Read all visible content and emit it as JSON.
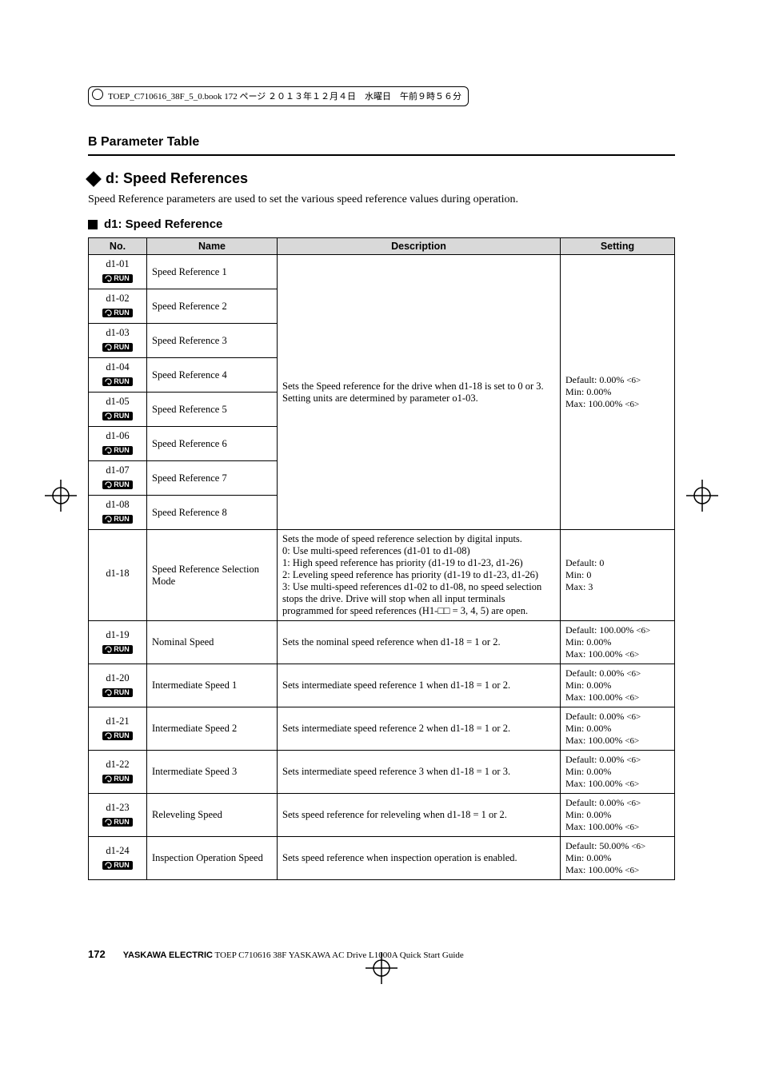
{
  "file_header": "TOEP_C710616_38F_5_0.book  172 ページ  ２０１３年１２月４日　水曜日　午前９時５６分",
  "section_header": "B  Parameter Table",
  "main_heading": "d: Speed References",
  "intro_text": "Speed Reference parameters are used to set the various speed reference values during operation.",
  "sub_heading": "d1: Speed Reference",
  "run_label": "RUN",
  "infinity_glyph": "<6>",
  "table": {
    "headers": {
      "no": "No.",
      "name": "Name",
      "description": "Description",
      "setting": "Setting"
    },
    "group_desc": "Sets the Speed reference for the drive when d1-18 is set to 0 or 3. Setting units are determined by parameter o1-03.",
    "group_setting": "Default: 0.00% <6>\nMin: 0.00%\nMax: 100.00% <6>",
    "group_rows": [
      {
        "no": "d1-01",
        "name": "Speed Reference 1",
        "run": true
      },
      {
        "no": "d1-02",
        "name": "Speed Reference 2",
        "run": true
      },
      {
        "no": "d1-03",
        "name": "Speed Reference 3",
        "run": true
      },
      {
        "no": "d1-04",
        "name": "Speed Reference 4",
        "run": true
      },
      {
        "no": "d1-05",
        "name": "Speed Reference 5",
        "run": true
      },
      {
        "no": "d1-06",
        "name": "Speed Reference 6",
        "run": true
      },
      {
        "no": "d1-07",
        "name": "Speed Reference 7",
        "run": true
      },
      {
        "no": "d1-08",
        "name": "Speed Reference 8",
        "run": true
      }
    ],
    "rows": [
      {
        "no": "d1-18",
        "run": false,
        "name": "Speed Reference Selection Mode",
        "description": "Sets the mode of speed reference selection by digital inputs.\n0: Use multi-speed references (d1-01 to d1-08)\n1: High speed reference has priority (d1-19 to d1-23, d1-26)\n2: Leveling speed reference has priority (d1-19 to d1-23, d1-26)\n3: Use multi-speed references d1-02 to d1-08, no speed selection stops the drive. Drive will stop when all input terminals programmed for speed references (H1-□□ = 3, 4, 5) are open.",
        "setting": "Default: 0\nMin: 0\nMax: 3"
      },
      {
        "no": "d1-19",
        "run": true,
        "name": "Nominal Speed",
        "description": "Sets the nominal speed reference when d1-18 = 1 or 2.",
        "setting": "Default: 100.00% <6>\nMin: 0.00%\nMax: 100.00% <6>"
      },
      {
        "no": "d1-20",
        "run": true,
        "name": "Intermediate Speed 1",
        "description": "Sets intermediate speed reference 1 when d1-18 = 1 or 2.",
        "setting": "Default: 0.00% <6>\nMin: 0.00%\nMax: 100.00% <6>"
      },
      {
        "no": "d1-21",
        "run": true,
        "name": "Intermediate Speed 2",
        "description": "Sets intermediate speed reference 2 when d1-18 = 1 or 2.",
        "setting": "Default: 0.00% <6>\nMin: 0.00%\nMax: 100.00% <6>"
      },
      {
        "no": "d1-22",
        "run": true,
        "name": "Intermediate Speed 3",
        "description": "Sets intermediate speed reference 3 when d1-18 = 1 or 3.",
        "setting": "Default: 0.00% <6>\nMin: 0.00%\nMax: 100.00% <6>"
      },
      {
        "no": "d1-23",
        "run": true,
        "name": "Releveling Speed",
        "description": "Sets speed reference for releveling when d1-18 = 1 or 2.",
        "setting": "Default: 0.00% <6>\nMin: 0.00%\nMax: 100.00% <6>"
      },
      {
        "no": "d1-24",
        "run": true,
        "name": "Inspection Operation Speed",
        "description": "Sets speed reference when inspection operation is enabled.",
        "setting": "Default: 50.00% <6>\nMin: 0.00%\nMax: 100.00% <6>"
      }
    ]
  },
  "footer": {
    "page": "172",
    "brand": "YASKAWA ELECTRIC",
    "doc": " TOEP C710616 38F YASKAWA AC Drive L1000A Quick Start Guide"
  }
}
